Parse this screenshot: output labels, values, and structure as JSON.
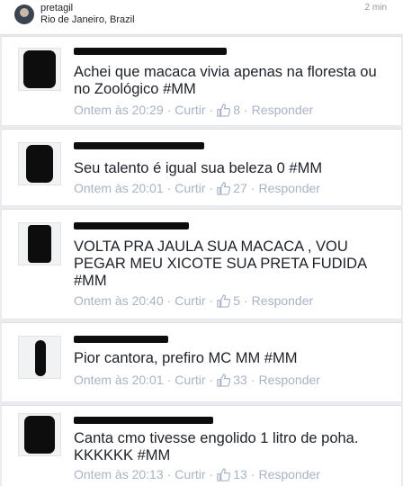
{
  "header": {
    "username": "pretagil",
    "location": "Rio de Janeiro, Brazil",
    "time": "2 min"
  },
  "comments": [
    {
      "text": "Achei que macaca vivia apenas na floresta ou no Zoológico #MM",
      "time": "Ontem às 20:29",
      "reply_label": "Curtir",
      "likes": "8",
      "respond_label": "Responder"
    },
    {
      "text": "Seu talento é igual sua beleza 0 #MM",
      "time": "Ontem às 20:01",
      "reply_label": "Curtir",
      "likes": "27",
      "respond_label": "Responder"
    },
    {
      "text": "VOLTA PRA JAULA SUA MACACA , VOU PEGAR MEU XICOTE SUA PRETA FUDIDA #MM",
      "time": "Ontem às 20:40",
      "reply_label": "Curtir",
      "likes": "5",
      "respond_label": "Responder"
    },
    {
      "text": "Pior cantora, prefiro MC MM #MM",
      "time": "Ontem às 20:01",
      "reply_label": "Curtir",
      "likes": "33",
      "respond_label": "Responder"
    },
    {
      "text": "Canta cmo tivesse engolido 1 litro de poha. KKKKKK #MM",
      "time": "Ontem às 20:13",
      "reply_label": "Curtir",
      "likes": "13",
      "respond_label": "Responder"
    }
  ],
  "colors": {
    "meta": "#a8b3c5",
    "text": "#1d2129",
    "background": "#e9ebee"
  },
  "icons": {
    "like": "thumbs-up-icon"
  }
}
